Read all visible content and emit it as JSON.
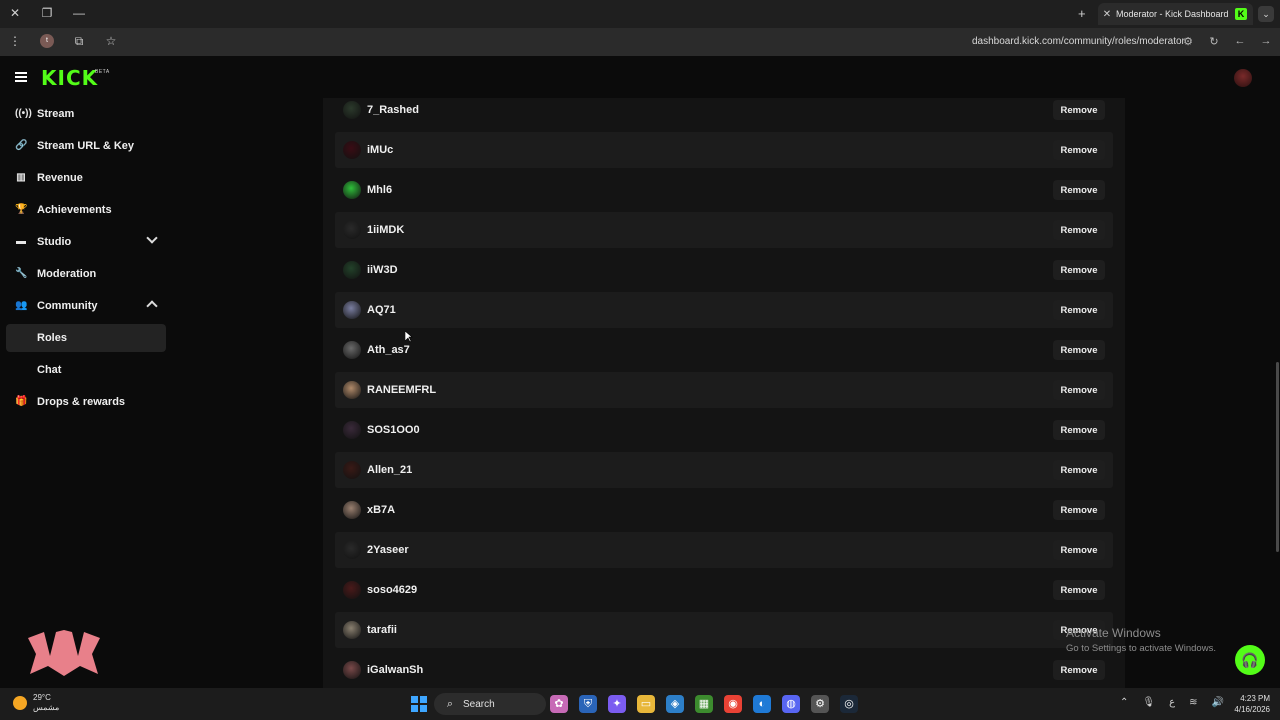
{
  "browser": {
    "tab_title": "Moderator - Kick Dashboard",
    "tab_favicon": "K",
    "url": "dashboard.kick.com/community/roles/moderator",
    "profile_initial": "t"
  },
  "header": {
    "logo": "KICK",
    "beta": "BETA"
  },
  "sidebar": {
    "items": [
      {
        "label": "Stream",
        "icon": "broadcast-icon"
      },
      {
        "label": "Stream URL & Key",
        "icon": "link-icon"
      },
      {
        "label": "Revenue",
        "icon": "chart-icon"
      },
      {
        "label": "Achievements",
        "icon": "trophy-icon"
      },
      {
        "label": "Studio",
        "icon": "studio-icon"
      },
      {
        "label": "Moderation",
        "icon": "wrench-icon"
      },
      {
        "label": "Community",
        "icon": "people-icon"
      },
      {
        "label": "Roles"
      },
      {
        "label": "Chat"
      },
      {
        "label": "Drops & rewards",
        "icon": "gift-icon"
      }
    ]
  },
  "moderators": {
    "remove_label": "Remove",
    "rows": [
      {
        "name": "7_Rashed",
        "avatar_color": "#2c3a2c"
      },
      {
        "name": "iMUc",
        "avatar_color": "#3a0c14"
      },
      {
        "name": "Mhl6",
        "avatar_color": "#2fbf3a"
      },
      {
        "name": "1iiMDK",
        "avatar_color": "#2a2a2a"
      },
      {
        "name": "iiW3D",
        "avatar_color": "#23422a"
      },
      {
        "name": "AQ71",
        "avatar_color": "#7a7ea0"
      },
      {
        "name": "Ath_as7",
        "avatar_color": "#6a6a6a"
      },
      {
        "name": "RANEEMFRL",
        "avatar_color": "#b08a6a"
      },
      {
        "name": "SOS1OO0",
        "avatar_color": "#3a2a3a"
      },
      {
        "name": "Allen_21",
        "avatar_color": "#3a1a16"
      },
      {
        "name": "xB7A",
        "avatar_color": "#9a8070"
      },
      {
        "name": "2Yaseer",
        "avatar_color": "#2a2a2a"
      },
      {
        "name": "soso4629",
        "avatar_color": "#4a1a1a"
      },
      {
        "name": "tarafii",
        "avatar_color": "#8a8070"
      },
      {
        "name": "iGalwanSh",
        "avatar_color": "#7a4a4a"
      }
    ]
  },
  "watermark": {
    "line1": "Activate Windows",
    "line2": "Go to Settings to activate Windows."
  },
  "taskbar": {
    "temp": "29°C",
    "weather_text": "مشمس",
    "search_label": "Search",
    "time": "4:23 PM",
    "date": "4/16/2026",
    "lang": "ع"
  },
  "colors": {
    "accent": "#53fc18",
    "panel": "#141414",
    "row_alt": "#1c1c1c"
  }
}
